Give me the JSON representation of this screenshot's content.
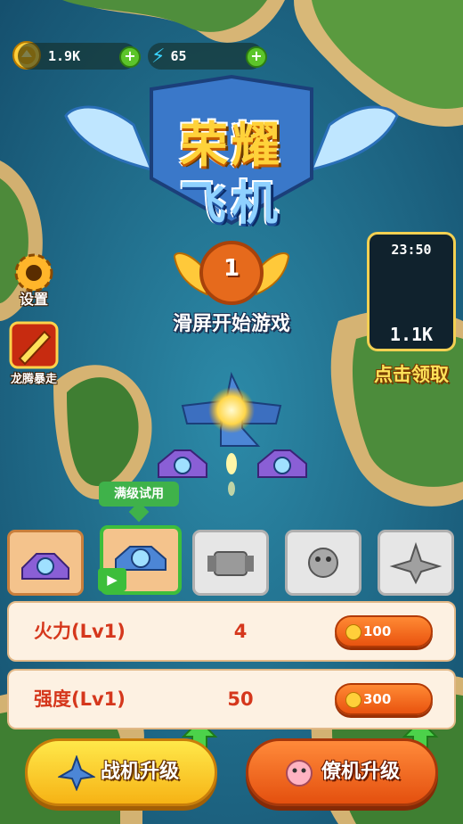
{
  "hud": {
    "coins": "1.9K",
    "energy": "65",
    "coin_icon": "coin-icon",
    "energy_icon": "lightning-icon",
    "add_icon": "plus-icon"
  },
  "title": {
    "line1": "荣耀",
    "line2": "飞机"
  },
  "level": {
    "number": "1"
  },
  "start_hint": "滑屏开始游戏",
  "side_menu": {
    "settings_label": "设置",
    "settings_icon": "gear-icon",
    "rampage_label": "龙腾暴走",
    "rampage_icon": "rocket-icon"
  },
  "piggy_bank": {
    "timer": "23:50",
    "amount": "1.1K",
    "claim_label": "点击领取",
    "icon": "piggy-bank-icon"
  },
  "trial_tooltip": "满级试用",
  "plane_cards": [
    {
      "icon": "purple-fighter-icon",
      "unlocked": true
    },
    {
      "icon": "blue-fighter-icon",
      "unlocked": true,
      "selected": true,
      "badge_icon": "video-icon"
    },
    {
      "icon": "gray-fighter-icon",
      "unlocked": false
    },
    {
      "icon": "gray-creature-icon",
      "unlocked": false
    },
    {
      "icon": "gray-jet-icon",
      "unlocked": false
    }
  ],
  "stats": [
    {
      "label": "火力(Lv1)",
      "value": "4",
      "cost": "100"
    },
    {
      "label": "强度(Lv1)",
      "value": "50",
      "cost": "300"
    }
  ],
  "buttons": {
    "plane_upgrade": "战机升级",
    "wingman_upgrade": "僚机升级",
    "up_arrow_icon": "up-arrow-icon"
  },
  "colors": {
    "accent_orange": "#e9530f",
    "accent_yellow": "#f6b315",
    "stat_text": "#d5371c",
    "select_green": "#3dbe3b"
  }
}
